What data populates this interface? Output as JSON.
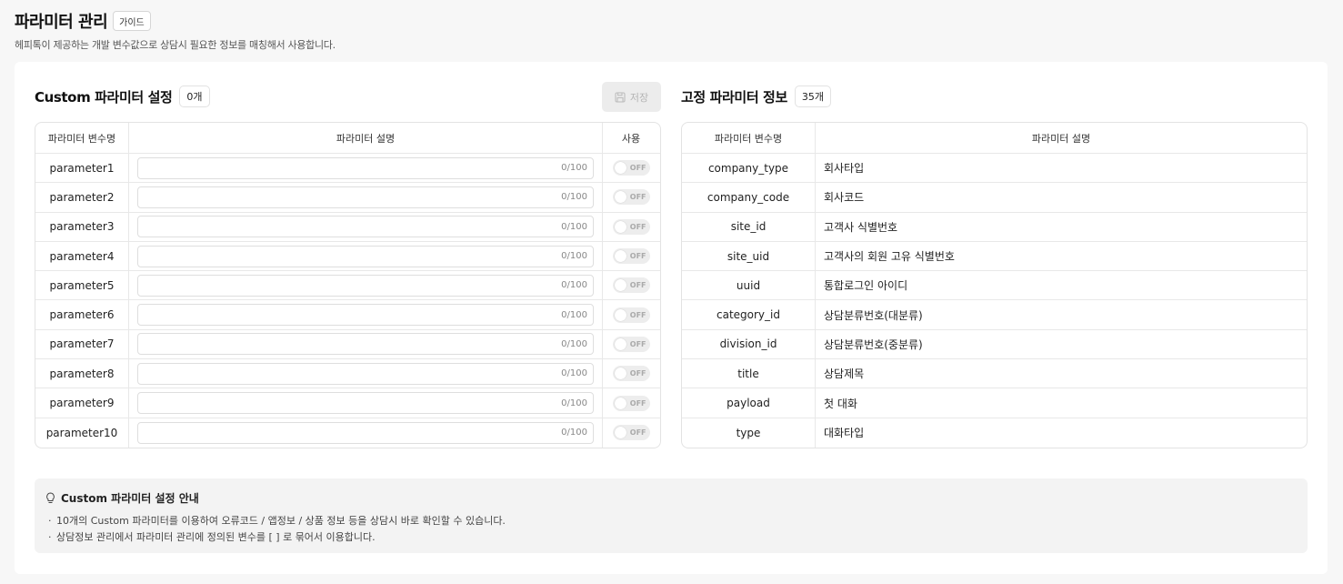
{
  "header": {
    "title": "파라미터 관리",
    "guide_label": "가이드",
    "subtitle": "헤피톡이 제공하는 개발 변수값으로 상담시 필요한 정보를 매칭해서 사용합니다."
  },
  "custom": {
    "title": "Custom 파라미터 설정",
    "count": "0개",
    "save_label": "저장",
    "columns": [
      "파라미터 변수명",
      "파라미터 설명",
      "사용"
    ],
    "rows": [
      {
        "name": "parameter1",
        "counter": "0/100",
        "toggle": "OFF"
      },
      {
        "name": "parameter2",
        "counter": "0/100",
        "toggle": "OFF"
      },
      {
        "name": "parameter3",
        "counter": "0/100",
        "toggle": "OFF"
      },
      {
        "name": "parameter4",
        "counter": "0/100",
        "toggle": "OFF"
      },
      {
        "name": "parameter5",
        "counter": "0/100",
        "toggle": "OFF"
      },
      {
        "name": "parameter6",
        "counter": "0/100",
        "toggle": "OFF"
      },
      {
        "name": "parameter7",
        "counter": "0/100",
        "toggle": "OFF"
      },
      {
        "name": "parameter8",
        "counter": "0/100",
        "toggle": "OFF"
      },
      {
        "name": "parameter9",
        "counter": "0/100",
        "toggle": "OFF"
      },
      {
        "name": "parameter10",
        "counter": "0/100",
        "toggle": "OFF"
      }
    ]
  },
  "fixed": {
    "title": "고정 파라미터 정보",
    "count": "35개",
    "columns": [
      "파라미터 변수명",
      "파라미터 설명"
    ],
    "rows": [
      {
        "name": "company_type",
        "desc": "회사타입"
      },
      {
        "name": "company_code",
        "desc": "회사코드"
      },
      {
        "name": "site_id",
        "desc": "고객사 식별번호"
      },
      {
        "name": "site_uid",
        "desc": "고객사의 회원 고유 식별번호"
      },
      {
        "name": "uuid",
        "desc": "통합로그인 아이디"
      },
      {
        "name": "category_id",
        "desc": "상담분류번호(대분류)"
      },
      {
        "name": "division_id",
        "desc": "상담분류번호(중분류)"
      },
      {
        "name": "title",
        "desc": "상담제목"
      },
      {
        "name": "payload",
        "desc": "첫 대화"
      },
      {
        "name": "type",
        "desc": "대화타입"
      }
    ]
  },
  "notice": {
    "icon": "lightbulb-icon",
    "title": "Custom 파라미터 설정 안내",
    "items": [
      "10개의 Custom 파라미터를 이용하여 오류코드 / 앱정보 / 상품 정보 등을 상담시 바로 확인할 수 있습니다.",
      "상담정보 관리에서 파라미터 관리에 정의된 변수를 [ ] 로 묶어서 이용합니다."
    ]
  },
  "icons": {
    "save": "floppy-disk-icon"
  },
  "colors": {
    "toggle_off": "#ededed",
    "disabled_button": "#ececec",
    "notice_bg": "#f3f3f3"
  }
}
